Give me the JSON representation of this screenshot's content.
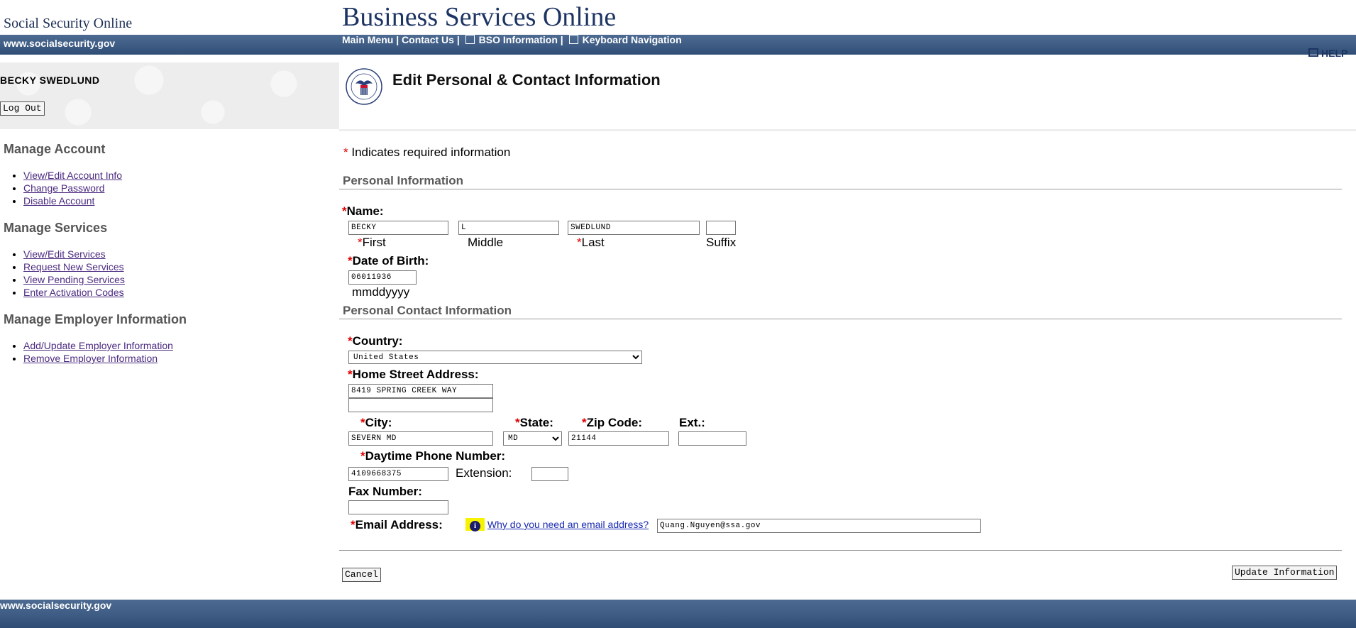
{
  "header": {
    "logo_text": "Social Security Online",
    "site_title": "Business Services Online",
    "site_url": "www.socialsecurity.gov",
    "nav": {
      "main_menu": "Main Menu",
      "contact_us": "Contact Us",
      "bso_information": "BSO Information",
      "keyboard_navigation": "Keyboard Navigation",
      "separator": "|"
    },
    "help_label": "HELP"
  },
  "user": {
    "name": "BECKY SWEDLUND",
    "logout_label": "Log Out"
  },
  "page_title": "Edit Personal & Contact Information",
  "sidebar": {
    "sections": [
      {
        "heading": "Manage Account",
        "items": [
          "View/Edit Account Info",
          "Change Password",
          "Disable Account"
        ]
      },
      {
        "heading": "Manage Services",
        "items": [
          "View/Edit Services",
          "Request New Services",
          "View Pending Services",
          "Enter Activation Codes"
        ]
      },
      {
        "heading": "Manage Employer Information",
        "items": [
          "Add/Update Employer Information",
          "Remove Employer Information"
        ]
      }
    ]
  },
  "form": {
    "required_marker": "*",
    "required_note": "Indicates required information",
    "personal_section": "Personal Information",
    "name_label": "Name:",
    "first_value": "BECKY",
    "middle_value": "L",
    "last_value": "SWEDLUND",
    "suffix_value": "",
    "first_label": "First",
    "middle_label": "Middle",
    "last_label": "Last",
    "suffix_label": "Suffix",
    "dob_label": "Date of Birth:",
    "dob_value": "06011936",
    "dob_format": "mmddyyyy",
    "contact_section": "Personal Contact Information",
    "country_label": "Country:",
    "country_value": "United States",
    "street_label": "Home Street Address:",
    "street_line1": "8419 SPRING CREEK WAY",
    "street_line2": "",
    "city_label": "City:",
    "city_value": "SEVERN MD",
    "state_label": "State:",
    "state_value": "MD",
    "zip_label": "Zip Code:",
    "zip_value": "21144",
    "ext_label": "Ext.:",
    "zip_ext_value": "",
    "phone_label": "Daytime Phone Number:",
    "phone_value": "4109668375",
    "extension_label": "Extension:",
    "phone_ext_value": "",
    "fax_label": "Fax Number:",
    "fax_value": "",
    "email_label": "Email Address:",
    "email_help": "Why do you need an email address?",
    "email_value": "Quang.Nguyen@ssa.gov"
  },
  "actions": {
    "cancel_label": "Cancel",
    "update_label": "Update Information"
  },
  "footer": {
    "url": "www.socialsecurity.gov"
  },
  "colors": {
    "header_bar": "#3c5a82",
    "title_navy": "#1d3463",
    "required_red": "#e00000",
    "visited_link": "#4b2a80",
    "help_highlight": "#f7f200"
  }
}
